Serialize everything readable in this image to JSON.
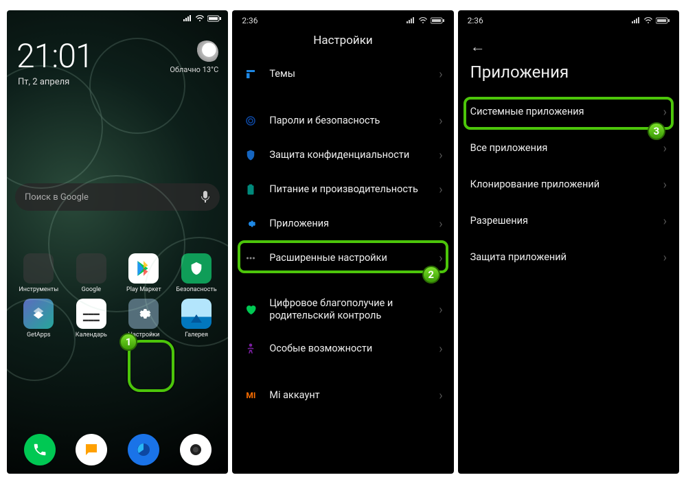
{
  "panel1": {
    "time": "21:01",
    "date": "Пт, 2 апреля",
    "weather": {
      "cond": "Облачно",
      "temp": "13°C"
    },
    "search_placeholder": "Поиск в Google",
    "apps_row1": [
      {
        "label": "Инструменты"
      },
      {
        "label": "Google"
      },
      {
        "label": "Play Маркет"
      },
      {
        "label": "Безопасность"
      }
    ],
    "apps_row2": [
      {
        "label": "GetApps"
      },
      {
        "label": "Календарь"
      },
      {
        "label": "Настройки"
      },
      {
        "label": "Галерея"
      }
    ]
  },
  "panel2": {
    "time": "2:36",
    "title": "Настройки",
    "items": [
      {
        "label": "Темы",
        "color": "#1e88e5"
      },
      {
        "label": "Пароли и безопасность",
        "color": "#0d47a1"
      },
      {
        "label": "Защита конфиденциальности",
        "color": "#1565c0"
      },
      {
        "label": "Питание и производительность",
        "color": "#00897b"
      },
      {
        "label": "Приложения",
        "color": "#1e88e5"
      },
      {
        "label": "Расширенные настройки",
        "color": "#616161"
      },
      {
        "label": "Цифровое благополучие и родительский контроль",
        "color": "#00c853"
      },
      {
        "label": "Особые возможности",
        "color": "#7b1fa2"
      },
      {
        "label": "Mi аккаунт",
        "color": "#ff6f00"
      }
    ]
  },
  "panel3": {
    "time": "2:36",
    "title": "Приложения",
    "items": [
      {
        "label": "Системные приложения"
      },
      {
        "label": "Все приложения"
      },
      {
        "label": "Клонирование приложений"
      },
      {
        "label": "Разрешения"
      },
      {
        "label": "Защита приложений"
      }
    ]
  },
  "callouts": {
    "n1": "1",
    "n2": "2",
    "n3": "3"
  }
}
